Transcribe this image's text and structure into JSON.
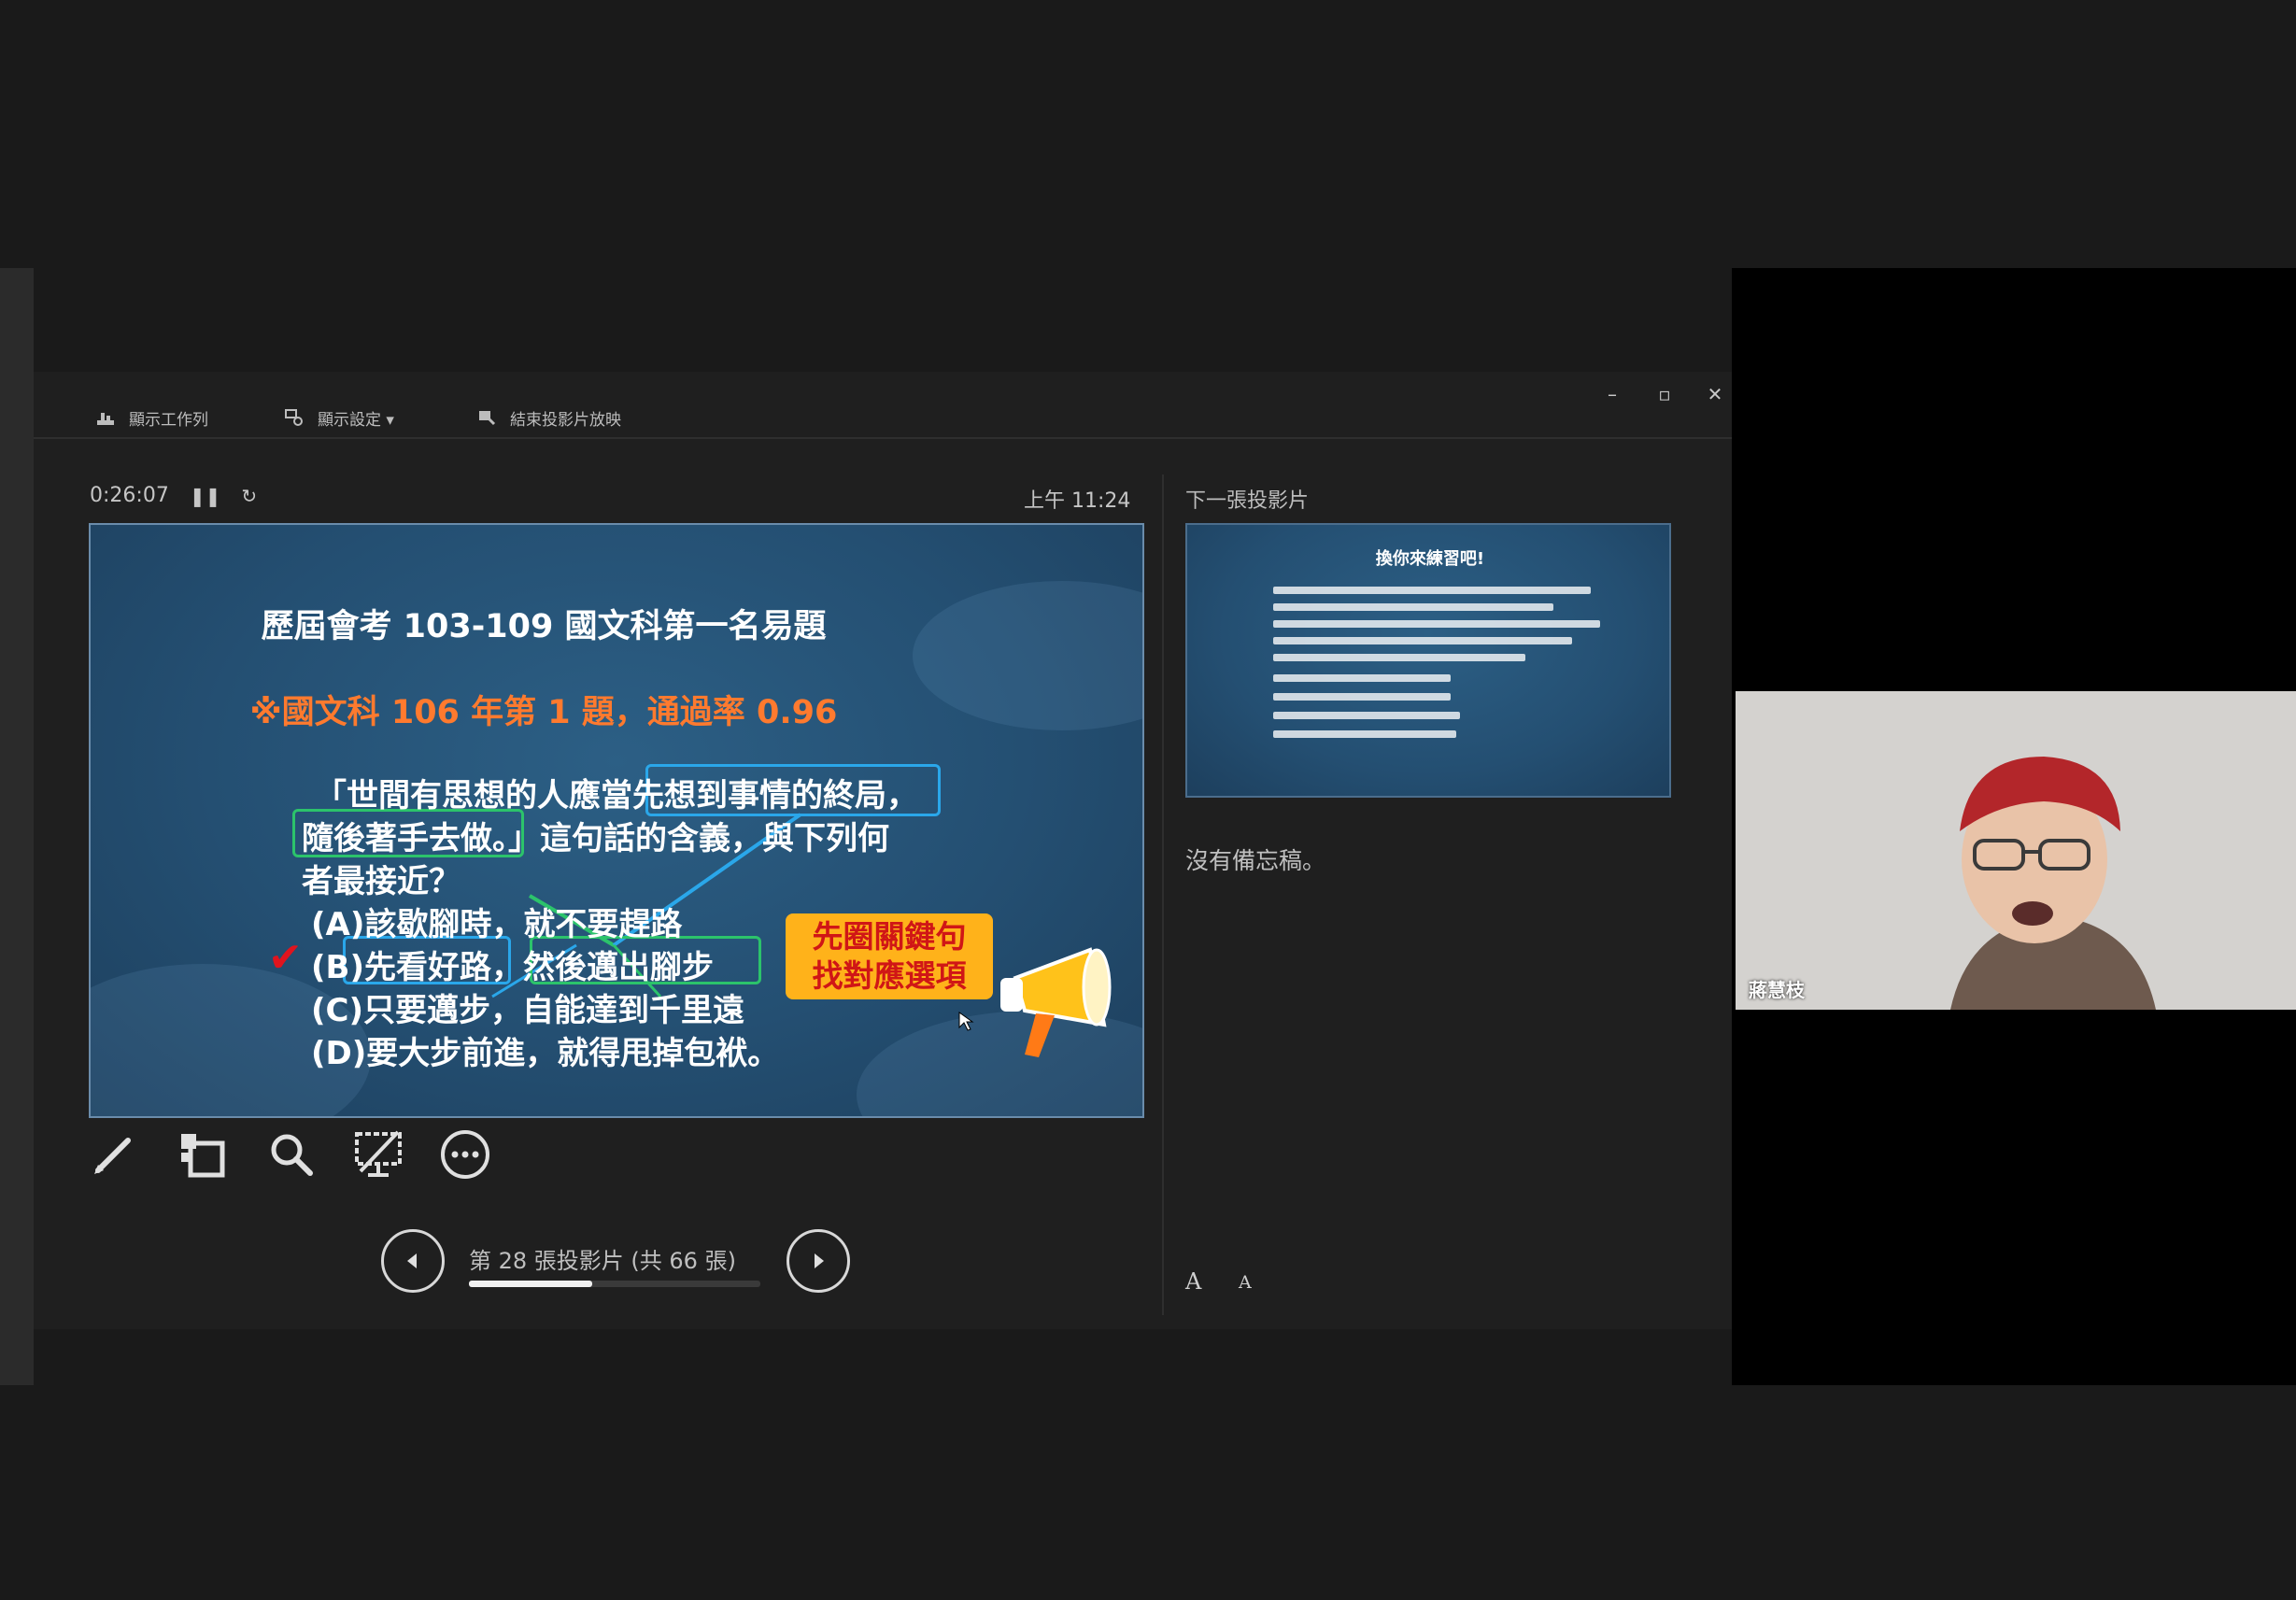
{
  "toolbar": {
    "taskbar_label": "顯示工作列",
    "display_settings_label": "顯示設定 ▾",
    "end_show_label": "結束投影片放映"
  },
  "window_controls": {
    "minimize": "–",
    "restore": "▫",
    "close": "✕"
  },
  "timer": {
    "elapsed": "0:26:07",
    "pause_icon": "pause-icon",
    "restart_icon": "restart-icon"
  },
  "clock": "上午 11:24",
  "current_slide": {
    "title": "歷屆會考 103-109 國文科第一名易題",
    "subtitle": "※國文科 106 年第 1 題，通過率 0.96",
    "question_line1": "「世間有思想的人應當先想到事情的終局，",
    "question_line2": "隨後著手去做。」這句話的含義，與下列何",
    "question_line3": "者最接近？",
    "option_a": "(A)該歇腳時，就不要趕路",
    "option_b": "(B)先看好路，然後邁出腳步",
    "option_c": "(C)只要邁步，自能達到千里遠",
    "option_d": "(D)要大步前進，就得甩掉包袱。",
    "callout_line1": "先圈關鍵句",
    "callout_line2": "找對應選項"
  },
  "slide_tools": [
    "pen-icon",
    "slides-grid-icon",
    "zoom-icon",
    "black-screen-icon",
    "more-options-icon"
  ],
  "navigation": {
    "counter": "第 28 張投影片 (共 66 張)",
    "current": 28,
    "total": 66,
    "progress_fraction": 0.424
  },
  "next_slide": {
    "label": "下一張投影片",
    "title": "換你來練習吧!"
  },
  "notes": {
    "empty_text": "沒有備忘稿。",
    "font_larger": "A",
    "font_smaller": "A"
  },
  "video": {
    "participant_name": "蔣慧枝"
  },
  "colors": {
    "slide_bg": "#244f72",
    "accent_orange": "#ff7a2e",
    "highlight_blue": "#2aa7ea",
    "highlight_green": "#2cc36b",
    "check_red": "#e0141e"
  }
}
